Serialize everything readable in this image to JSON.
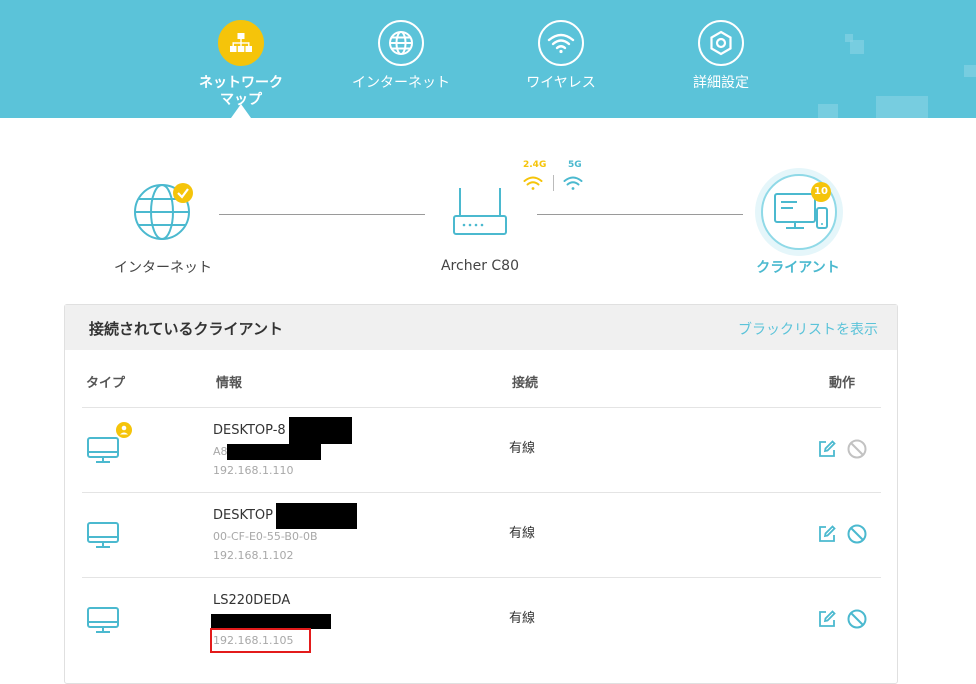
{
  "nav": {
    "items": [
      {
        "label": "ネットワーク",
        "label2": "マップ",
        "icon": "network-map-icon",
        "active": true
      },
      {
        "label": "インターネット",
        "icon": "globe-icon",
        "active": false
      },
      {
        "label": "ワイヤレス",
        "icon": "wifi-icon",
        "active": false
      },
      {
        "label": "詳細設定",
        "icon": "gear-icon",
        "active": false
      }
    ]
  },
  "topology": {
    "internet_label": "インターネット",
    "router_label": "Archer C80",
    "band_24": "2.4G",
    "band_5": "5G",
    "clients_label": "クライアント",
    "client_count": "10"
  },
  "clients_panel": {
    "title": "接続されているクライアント",
    "blacklist_link": "ブラックリストを表示",
    "columns": {
      "type": "タイプ",
      "info": "情報",
      "connection": "接続",
      "action": "動作"
    },
    "rows": [
      {
        "name": "DESKTOP-8",
        "mac": "A8",
        "ip": "192.168.1.110",
        "connection": "有線"
      },
      {
        "name": "DESKTOP",
        "mac": "00-CF-E0-55-B0-0B",
        "ip": "192.168.1.102",
        "connection": "有線"
      },
      {
        "name": "LS220DEDA",
        "mac": "",
        "ip": "192.168.1.105",
        "connection": "有線"
      }
    ]
  },
  "colors": {
    "header": "#5bc3d9",
    "accent_yellow": "#f5c40a",
    "teal": "#5bc3d9",
    "highlight_red": "#e31b1b"
  }
}
